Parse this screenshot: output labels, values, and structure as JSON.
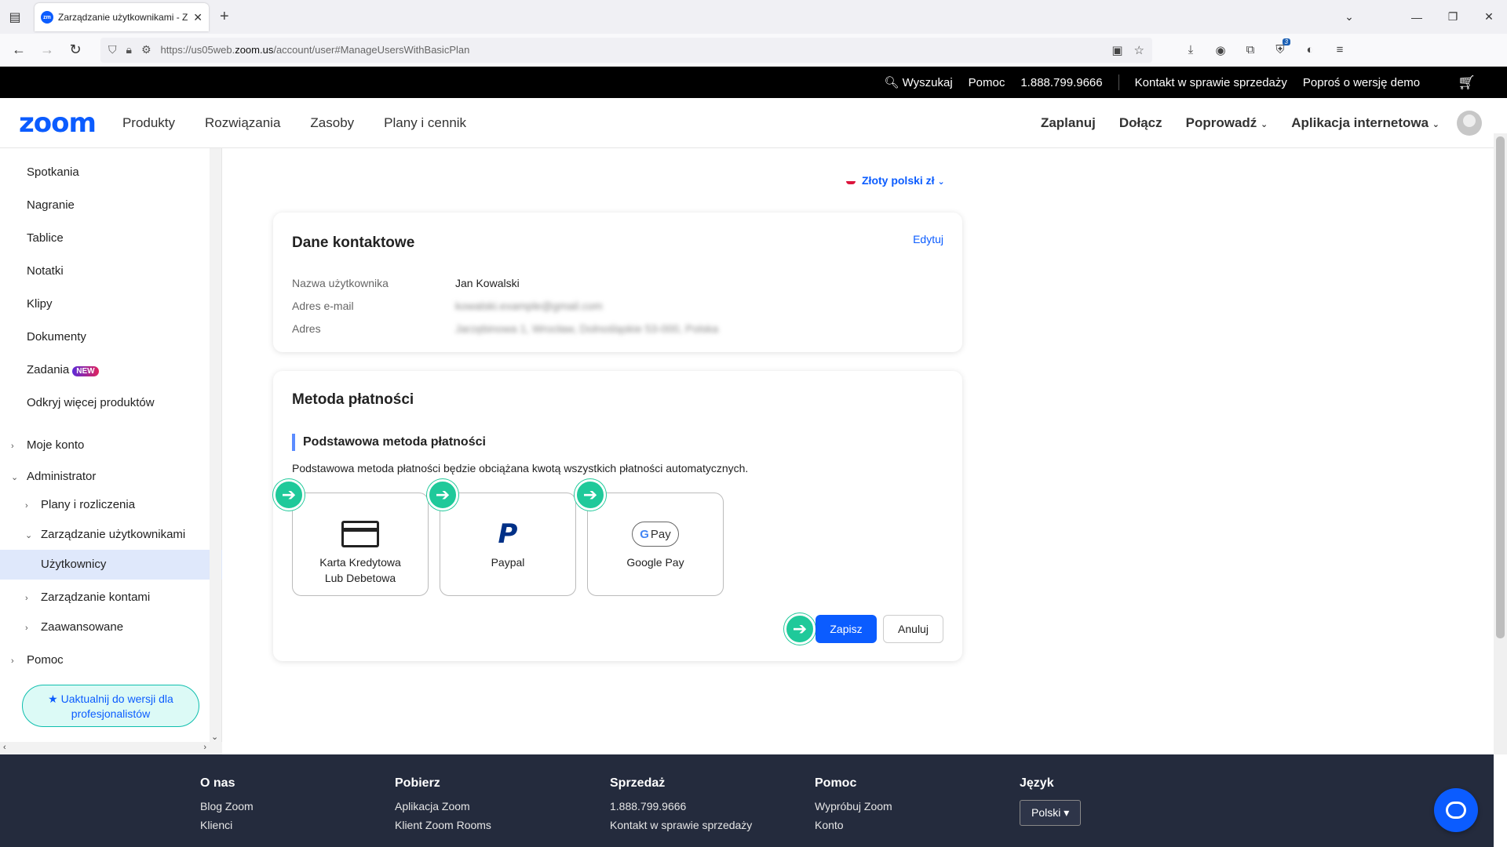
{
  "browser": {
    "tab_title": "Zarządzanie użytkownikami - Z",
    "tab_favicon": "zm",
    "url_prefix": "https://us05web.",
    "url_domain": "zoom.us",
    "url_path": "/account/user#ManageUsersWithBasicPlan",
    "extension_badge": "3"
  },
  "topbar": {
    "search": "Wyszukaj",
    "help": "Pomoc",
    "phone": "1.888.799.9666",
    "sales": "Kontakt w sprawie sprzedaży",
    "demo": "Poproś o wersję demo"
  },
  "mainnav": {
    "logo": "zoom",
    "links": [
      "Produkty",
      "Rozwiązania",
      "Zasoby",
      "Plany i cennik"
    ],
    "right": [
      "Zaplanuj",
      "Dołącz",
      "Poprowadź",
      "Aplikacja internetowa"
    ]
  },
  "sidebar": {
    "items": [
      "Spotkania",
      "Nagranie",
      "Tablice",
      "Notatki",
      "Klipy",
      "Dokumenty",
      "Zadania",
      "Odkryj więcej produktów"
    ],
    "new_badge": "NEW",
    "my_account": "Moje konto",
    "admin": "Administrator",
    "plans": "Plany i rozliczenia",
    "user_mgmt": "Zarządzanie użytkownikami",
    "users": "Użytkownicy",
    "account_mgmt": "Zarządzanie kontami",
    "advanced": "Zaawansowane",
    "help": "Pomoc",
    "upgrade": "Uaktualnij do wersji dla profesjonalistów"
  },
  "currency": "Złoty polski zł",
  "contact": {
    "title": "Dane kontaktowe",
    "edit": "Edytuj",
    "name_label": "Nazwa użytkownika",
    "name_value": "Jan Kowalski",
    "email_label": "Adres e-mail",
    "email_value": "kowalski.example@gmail.com",
    "address_label": "Adres",
    "address_value": "Jarzębinowa 1, Wrocław, Dolnośląskie 53-000, Polska"
  },
  "payment": {
    "title": "Metoda płatności",
    "subtitle": "Podstawowa metoda płatności",
    "description": "Podstawowa metoda płatności będzie obciążana kwotą wszystkich płatności automatycznych.",
    "card_line1": "Karta Kredytowa",
    "card_line2": "Lub Debetowa",
    "paypal": "Paypal",
    "gpay": "Google Pay",
    "gpay_icon_text": "Pay",
    "save": "Zapisz",
    "cancel": "Anuluj"
  },
  "footer": {
    "about": {
      "title": "O nas",
      "items": [
        "Blog Zoom",
        "Klienci"
      ]
    },
    "download": {
      "title": "Pobierz",
      "items": [
        "Aplikacja Zoom",
        "Klient Zoom Rooms"
      ]
    },
    "sales": {
      "title": "Sprzedaż",
      "items": [
        "1.888.799.9666",
        "Kontakt w sprawie sprzedaży"
      ]
    },
    "help": {
      "title": "Pomoc",
      "items": [
        "Wypróbuj Zoom",
        "Konto"
      ]
    },
    "lang": {
      "title": "Język",
      "button": "Polski"
    }
  },
  "colors": {
    "accent": "#0b5cff",
    "arrow": "#1fc99a",
    "footer": "#242b3d"
  }
}
